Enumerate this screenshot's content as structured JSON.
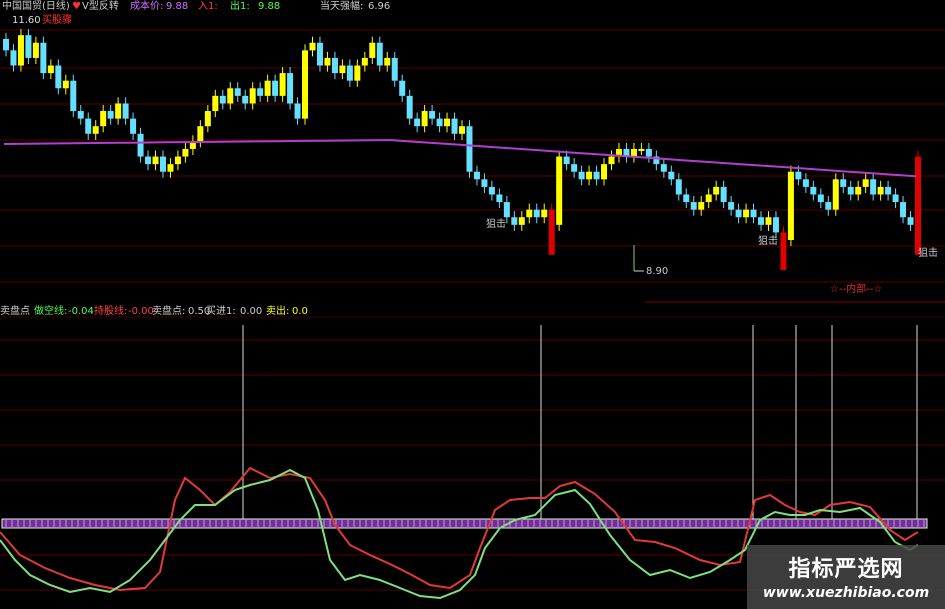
{
  "colors": {
    "background": "#000000",
    "grid": "#5a0000",
    "up_candle": "#ffff00",
    "down_candle": "#66e0ff",
    "signal_candle": "#e00000",
    "cost_line": "#b040d0",
    "cost_line_low": "#7fd07f",
    "kdj_red": "#e03a3a",
    "kdj_green": "#7fe07f",
    "zero_band_fill": "#7a2aa0",
    "zero_band_border": "#d0ffd0",
    "signal_vline": "#d8d8d8"
  },
  "top_header": {
    "title": "中国国贸(日线)",
    "indicator": "V型反转",
    "cost_label": "成本价:",
    "cost_value": "9.88",
    "in_label": "入1:",
    "out_label": "出1:",
    "out_value": "9.88",
    "strength_label": "当天强幅:",
    "strength_value": "6.96",
    "price_high": "11.60",
    "buy_tag": "买股骤"
  },
  "annotations": {
    "snipe1": "狙击",
    "snipe2": "狙击",
    "snipe3": "狙击",
    "low_price": "8.90",
    "footer_mark": "☆--内部--☆"
  },
  "bottom_header": {
    "item1_label": "卖盘点",
    "item2_label": "做空线:",
    "item2_value": "-0.04",
    "item3_label": "持股线:",
    "item3_value": "-0.00",
    "item4_label": "卖盘点:",
    "item4_value": "0.50",
    "item5_label": "买进1:",
    "item5_value": "0.00",
    "item6_label": "卖出:",
    "item6_value": "0.0"
  },
  "watermark": {
    "title": "指标严选网",
    "url": "www.xuezhibiao.com"
  },
  "chart_data": {
    "type": "candlestick",
    "close": [
      11.2,
      11.0,
      11.4,
      11.1,
      11.3,
      10.9,
      11.0,
      10.7,
      10.8,
      10.4,
      10.3,
      10.1,
      10.2,
      10.4,
      10.3,
      10.5,
      10.3,
      10.1,
      9.8,
      9.7,
      9.8,
      9.6,
      9.7,
      9.8,
      9.9,
      10.0,
      10.2,
      10.4,
      10.6,
      10.5,
      10.7,
      10.6,
      10.5,
      10.7,
      10.6,
      10.8,
      10.6,
      10.9,
      10.5,
      10.3,
      11.2,
      11.3,
      11.0,
      11.1,
      10.9,
      11.0,
      10.8,
      11.0,
      11.1,
      11.3,
      11.0,
      11.1,
      10.8,
      10.6,
      10.3,
      10.2,
      10.4,
      10.3,
      10.2,
      10.3,
      10.1,
      10.2,
      9.6,
      9.5,
      9.4,
      9.3,
      9.2,
      9.0,
      8.9,
      9.0,
      9.1,
      9.0,
      9.1,
      8.9,
      9.8,
      9.7,
      9.6,
      9.5,
      9.6,
      9.5,
      9.7,
      9.8,
      9.9,
      9.8,
      9.9,
      9.9,
      9.8,
      9.7,
      9.6,
      9.5,
      9.3,
      9.2,
      9.1,
      9.2,
      9.3,
      9.4,
      9.2,
      9.1,
      9.0,
      9.1,
      9.0,
      8.9,
      9.0,
      8.8,
      8.7,
      9.6,
      9.5,
      9.4,
      9.3,
      9.2,
      9.1,
      9.5,
      9.4,
      9.3,
      9.4,
      9.5,
      9.3,
      9.4,
      9.3,
      9.2,
      9.0,
      8.9,
      9.8
    ]
  }
}
